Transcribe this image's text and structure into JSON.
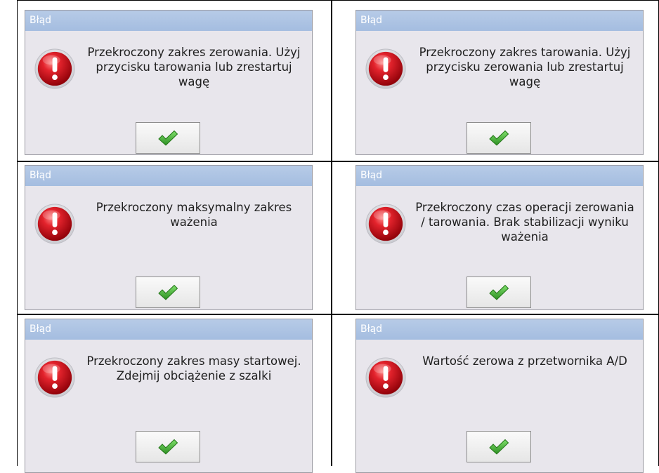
{
  "dialogs": [
    {
      "title": "Błąd",
      "message": "Przekroczony zakres zerowania. Użyj przycisku tarowania lub zrestartuj wagę",
      "ok_icon": "checkmark-icon",
      "status_icon": "error-exclamation-icon"
    },
    {
      "title": "Błąd",
      "message": "Przekroczony zakres tarowania. Użyj przycisku zerowania lub zrestartuj wagę",
      "ok_icon": "checkmark-icon",
      "status_icon": "error-exclamation-icon"
    },
    {
      "title": "Błąd",
      "message": "Przekroczony maksymalny zakres ważenia",
      "ok_icon": "checkmark-icon",
      "status_icon": "error-exclamation-icon"
    },
    {
      "title": "Błąd",
      "message": "Przekroczony czas operacji zerowania / tarowania. Brak stabilizacji wyniku ważenia",
      "ok_icon": "checkmark-icon",
      "status_icon": "error-exclamation-icon"
    },
    {
      "title": "Błąd",
      "message": "Przekroczony zakres masy startowej. Zdejmij obciążenie z szalki",
      "ok_icon": "checkmark-icon",
      "status_icon": "error-exclamation-icon"
    },
    {
      "title": "Błąd",
      "message": "Wartość zerowa z przetwornika A/D",
      "ok_icon": "checkmark-icon",
      "status_icon": "error-exclamation-icon"
    }
  ],
  "colors": {
    "titlebar": "#a8c0e2",
    "dialog_bg": "#e8e6ec",
    "error_red": "#c8101a",
    "check_green": "#3aa02a"
  }
}
